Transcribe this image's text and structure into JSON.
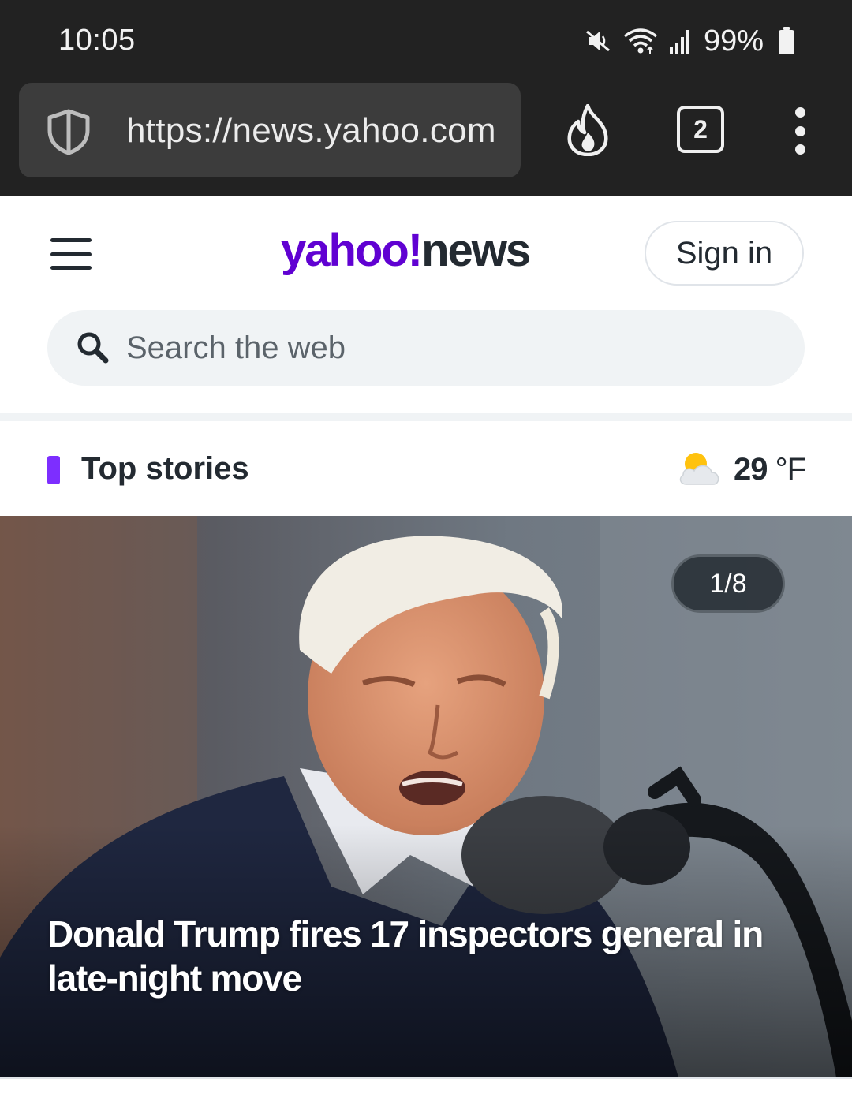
{
  "status_bar": {
    "time": "10:05",
    "battery": "99%",
    "icons": [
      "mute-icon",
      "wifi-icon",
      "signal-icon",
      "battery-icon"
    ]
  },
  "browser": {
    "url": "https://news.yahoo.com",
    "tab_count": "2",
    "icons": [
      "shield-icon",
      "fire-icon",
      "tabs-icon",
      "more-icon"
    ]
  },
  "header": {
    "logo_yahoo": "yahoo!",
    "logo_news": "news",
    "signin_label": "Sign in",
    "menu_icon": "hamburger-icon"
  },
  "search": {
    "placeholder": "Search the web",
    "icon": "search-icon"
  },
  "top_stories": {
    "title": "Top stories",
    "temperature": "29",
    "temperature_unit": "°F",
    "weather_icon": "partly-cloudy-icon"
  },
  "hero_story": {
    "counter": "1/8",
    "headline": "Donald Trump fires 17 inspectors general in late-night move"
  },
  "colors": {
    "chrome_bg": "#222222",
    "yahoo_purple": "#6001d2",
    "accent_bar": "#7d2eff",
    "text_dark": "#232a31",
    "search_bg": "#f0f3f5"
  }
}
